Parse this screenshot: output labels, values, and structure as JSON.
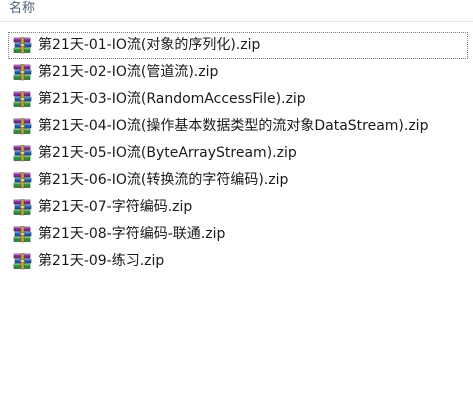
{
  "header": {
    "name_column": "名称"
  },
  "files": [
    {
      "name": "第21天-01-IO流(对象的序列化).zip",
      "icon": "winrar-archive-icon"
    },
    {
      "name": "第21天-02-IO流(管道流).zip",
      "icon": "winrar-archive-icon"
    },
    {
      "name": "第21天-03-IO流(RandomAccessFile).zip",
      "icon": "winrar-archive-icon"
    },
    {
      "name": "第21天-04-IO流(操作基本数据类型的流对象DataStream).zip",
      "icon": "winrar-archive-icon"
    },
    {
      "name": "第21天-05-IO流(ByteArrayStream).zip",
      "icon": "winrar-archive-icon"
    },
    {
      "name": "第21天-06-IO流(转换流的字符编码).zip",
      "icon": "winrar-archive-icon"
    },
    {
      "name": "第21天-07-字符编码.zip",
      "icon": "winrar-archive-icon"
    },
    {
      "name": "第21天-08-字符编码-联通.zip",
      "icon": "winrar-archive-icon"
    },
    {
      "name": "第21天-09-练习.zip",
      "icon": "winrar-archive-icon"
    }
  ],
  "colors": {
    "header_text": "#4c607a",
    "file_text": "#1a1a1a"
  }
}
